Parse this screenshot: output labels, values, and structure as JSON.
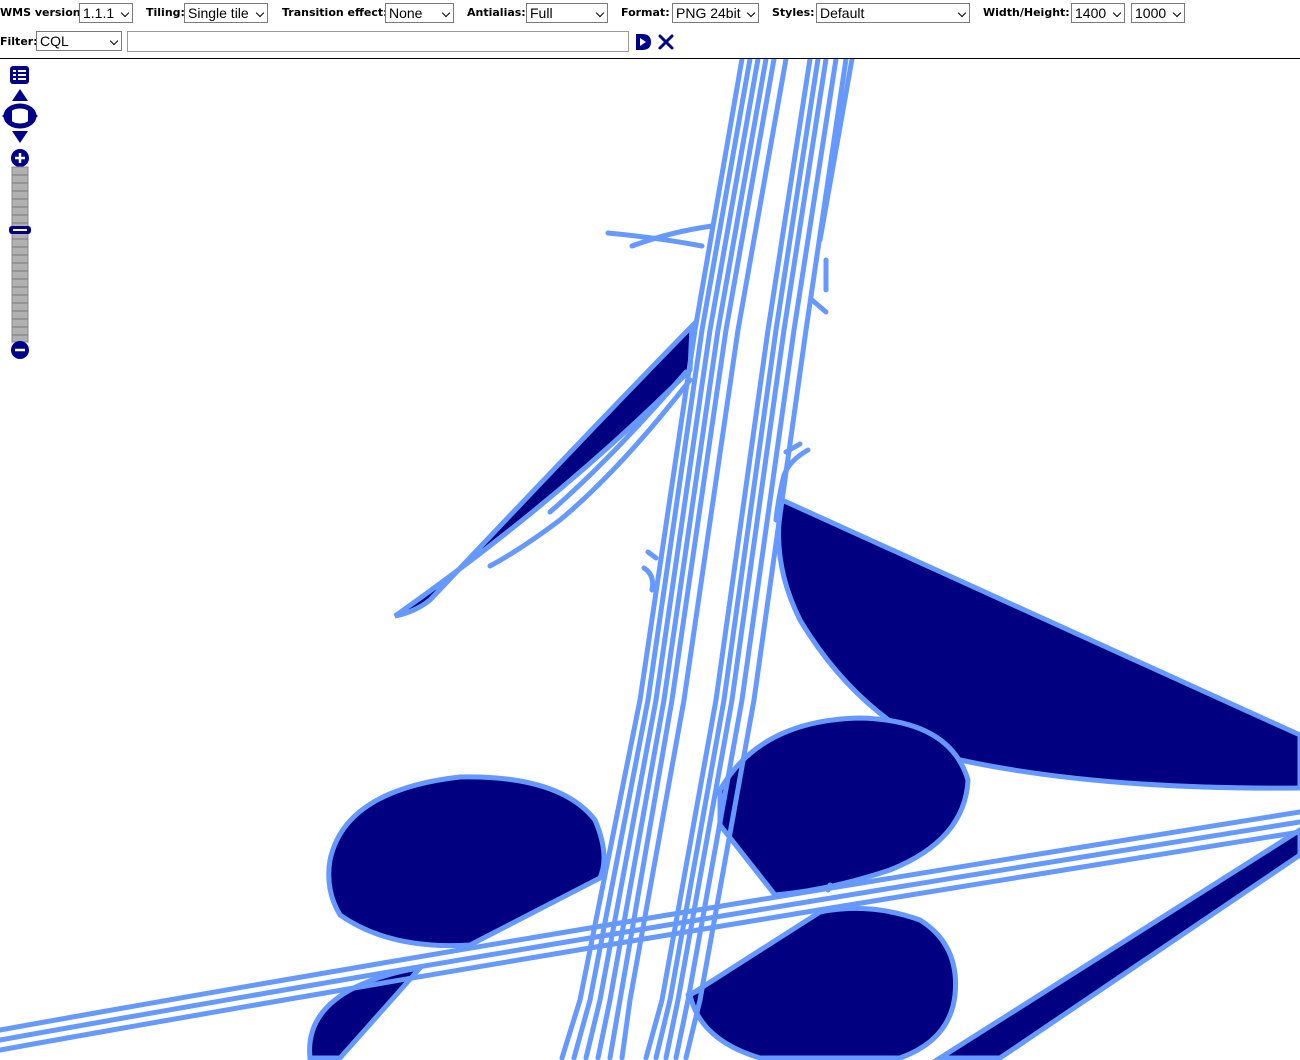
{
  "toolbar": {
    "wms_version": {
      "label": "WMS version:",
      "value": "1.1.1"
    },
    "tiling": {
      "label": "Tiling:",
      "value": "Single tile"
    },
    "transition": {
      "label": "Transition effect:",
      "value": "None"
    },
    "antialias": {
      "label": "Antialias:",
      "value": "Full"
    },
    "format": {
      "label": "Format:",
      "value": "PNG 24bit"
    },
    "styles": {
      "label": "Styles:",
      "value": "Default"
    },
    "size": {
      "label": "Width/Height:",
      "width": "1400",
      "height": "1000"
    }
  },
  "filter": {
    "label": "Filter:",
    "type": "CQL",
    "value": "",
    "apply_icon": "play-icon",
    "clear_icon": "close-icon"
  },
  "map_controls": {
    "layer_switcher_icon": "layer-list-icon",
    "pan_icon": "pan-arrows-icon",
    "zoom_in_icon": "plus-icon",
    "zoom_out_icon": "minus-icon",
    "zoom_level_fraction": 0.36
  },
  "colors": {
    "road": "#6699ff",
    "polygon": "#000080",
    "control": "#00008b"
  }
}
